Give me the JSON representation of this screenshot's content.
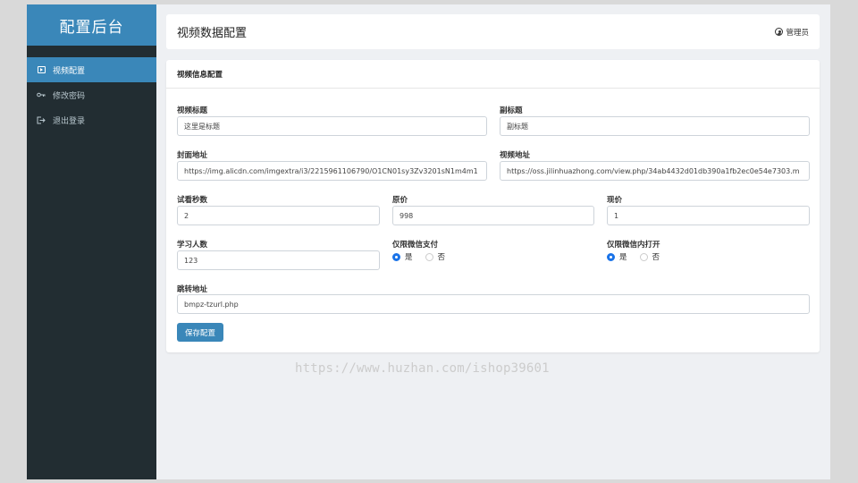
{
  "sidebar": {
    "brand": "配置后台",
    "items": [
      {
        "label": "视频配置",
        "icon": "play-square-icon",
        "active": true
      },
      {
        "label": "修改密码",
        "icon": "key-icon",
        "active": false
      },
      {
        "label": "退出登录",
        "icon": "logout-icon",
        "active": false
      }
    ]
  },
  "header": {
    "title": "视频数据配置",
    "user": "管理员"
  },
  "form": {
    "section_title": "视频信息配置",
    "video_title": {
      "label": "视频标题",
      "value": "这里是标题"
    },
    "subtitle": {
      "label": "副标题",
      "value": "副标题"
    },
    "cover_url": {
      "label": "封面地址",
      "value": "https://img.alicdn.com/imgextra/i3/2215961106790/O1CN01sy3Zv3201sN1m4m1"
    },
    "video_url": {
      "label": "视频地址",
      "value": "https://oss.jilinhuazhong.com/view.php/34ab4432d01db390a1fb2ec0e54e7303.m"
    },
    "trial_seconds": {
      "label": "试看秒数",
      "value": "2"
    },
    "original_price": {
      "label": "原价",
      "value": "998"
    },
    "current_price": {
      "label": "现价",
      "value": "1"
    },
    "learners": {
      "label": "学习人数",
      "value": "123"
    },
    "wechat_pay_only": {
      "label": "仅限微信支付",
      "options": [
        "是",
        "否"
      ],
      "selected": "是"
    },
    "wechat_open_only": {
      "label": "仅限微信内打开",
      "options": [
        "是",
        "否"
      ],
      "selected": "是"
    },
    "redirect_url": {
      "label": "跳转地址",
      "value": "bmpz-tzurl.php"
    },
    "save_label": "保存配置"
  },
  "watermark": "https://www.huzhan.com/ishop39601",
  "colors": {
    "sidebar_bg": "#222d32",
    "accent": "#3a87b9",
    "radio_on": "#1a73e8"
  }
}
